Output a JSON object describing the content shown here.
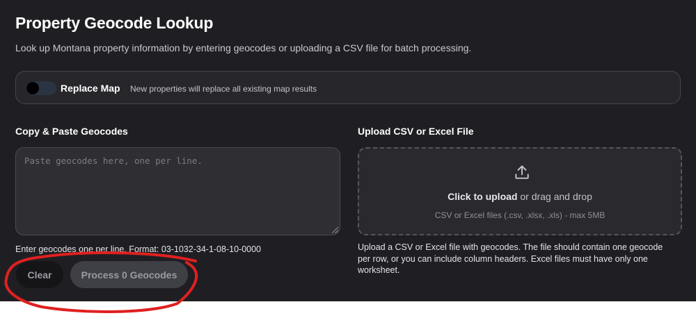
{
  "header": {
    "title": "Property Geocode Lookup",
    "subtitle": "Look up Montana property information by entering geocodes or uploading a CSV file for batch processing."
  },
  "replace_map": {
    "label": "Replace Map",
    "description": "New properties will replace all existing map results",
    "enabled": false
  },
  "paste_section": {
    "label": "Copy & Paste Geocodes",
    "value": "",
    "placeholder": "Paste geocodes here, one per line.",
    "hint": "Enter geocodes one per line. Format: 03-1032-34-1-08-10-0000"
  },
  "buttons": {
    "clear_label": "Clear",
    "process_label": "Process 0 Geocodes"
  },
  "upload_section": {
    "label": "Upload CSV or Excel File",
    "click_text": "Click to upload",
    "drag_text": " or drag and drop",
    "file_types": "CSV or Excel files (.csv, .xlsx, .xls) - max 5MB",
    "help": "Upload a CSV or Excel file with geocodes. The file should contain one geocode per row, or you can include column headers. Excel files must have only one worksheet."
  },
  "icons": {
    "upload": "upload-icon"
  },
  "colors": {
    "panel_background": "#1f1f23",
    "annotation": "#e02020"
  }
}
